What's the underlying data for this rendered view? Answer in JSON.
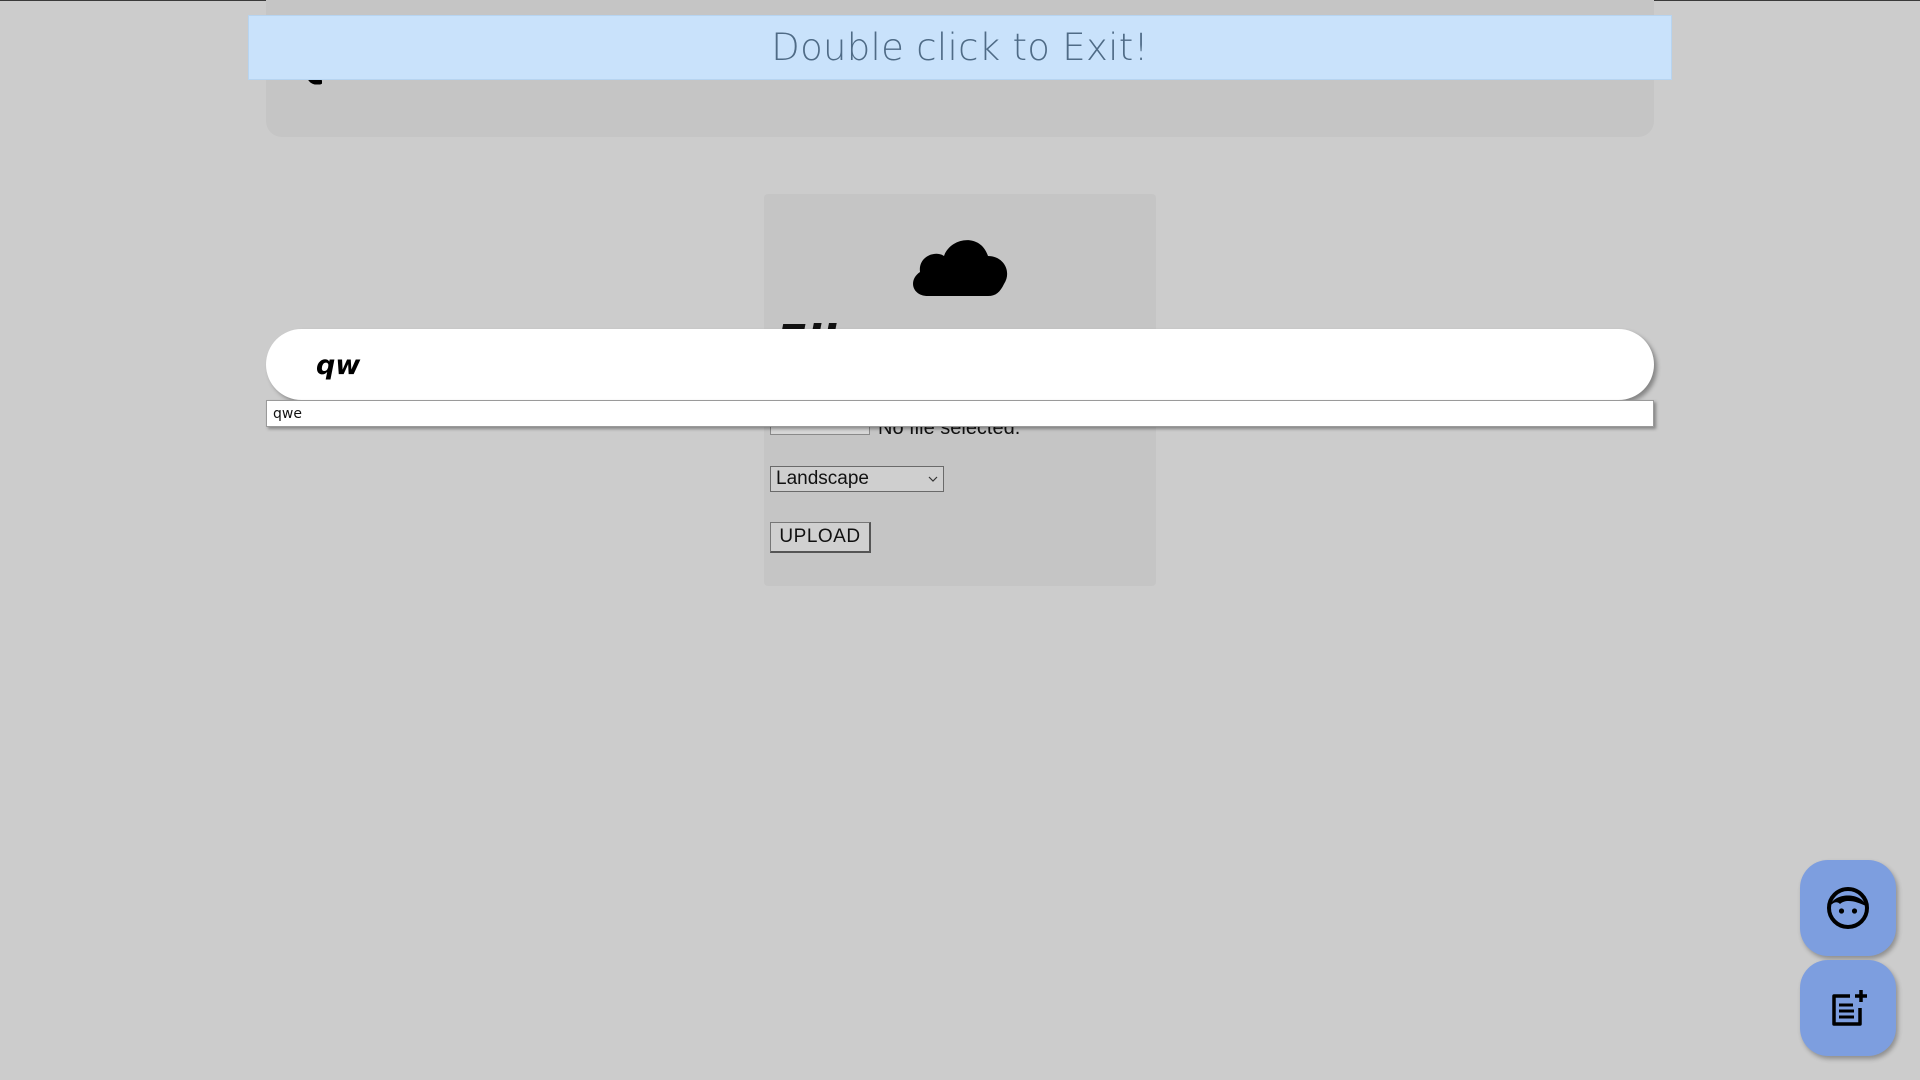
{
  "banner": {
    "message": "Double click to Exit!"
  },
  "search": {
    "value": "qw",
    "suggestions": [
      "qwe"
    ]
  },
  "upload_card": {
    "icon": "cloud-icon",
    "title_partial": "File Upload",
    "browse_label": "Browse...",
    "file_status": "No file selected.",
    "orientation_selected": "Landscape",
    "upload_label": "UPLOAD"
  },
  "fabs": [
    {
      "icon": "face-icon"
    },
    {
      "icon": "note-add-icon"
    }
  ],
  "colors": {
    "background": "#cccccc",
    "panel": "#c5c5c5",
    "banner_bg": "#c9e2fb",
    "banner_text": "#4f6b86",
    "fab": "#7d9edf"
  }
}
